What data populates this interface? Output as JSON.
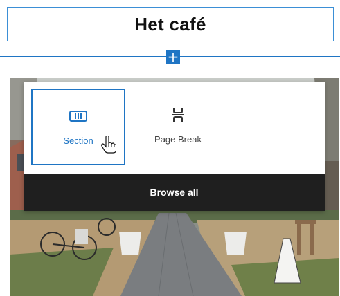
{
  "heading": {
    "text": "Het café"
  },
  "inserter": {
    "plus_symbol": "+"
  },
  "popover": {
    "blocks": [
      {
        "label": "Section",
        "icon": "section-icon",
        "selected": true
      },
      {
        "label": "Page Break",
        "icon": "page-break-icon",
        "selected": false
      }
    ],
    "browse_all_label": "Browse all"
  },
  "colors": {
    "accent": "#1f75c4",
    "dark": "#1f1f1f"
  }
}
